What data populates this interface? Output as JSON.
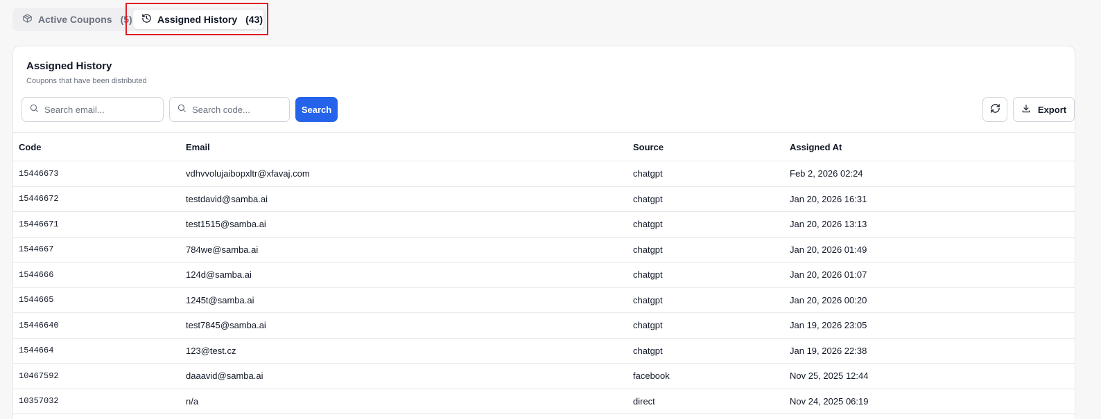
{
  "tabs": [
    {
      "label": "Active Coupons",
      "count": "(5)",
      "icon": "package-icon"
    },
    {
      "label": "Assigned History",
      "count": "(43)",
      "icon": "history-icon"
    }
  ],
  "card": {
    "title": "Assigned History",
    "subtitle": "Coupons that have been distributed"
  },
  "toolbar": {
    "email_placeholder": "Search email...",
    "code_placeholder": "Search code...",
    "search_label": "Search",
    "export_label": "Export"
  },
  "table": {
    "headers": [
      "Code",
      "Email",
      "Source",
      "Assigned At"
    ],
    "rows": [
      {
        "code": "15446673",
        "email": "vdhvvolujaibopxltr@xfavaj.com",
        "source": "chatgpt",
        "assigned_at": "Feb 2, 2026 02:24"
      },
      {
        "code": "15446672",
        "email": "testdavid@samba.ai",
        "source": "chatgpt",
        "assigned_at": "Jan 20, 2026 16:31"
      },
      {
        "code": "15446671",
        "email": "test1515@samba.ai",
        "source": "chatgpt",
        "assigned_at": "Jan 20, 2026 13:13"
      },
      {
        "code": "1544667",
        "email": "784we@samba.ai",
        "source": "chatgpt",
        "assigned_at": "Jan 20, 2026 01:49"
      },
      {
        "code": "1544666",
        "email": "124d@samba.ai",
        "source": "chatgpt",
        "assigned_at": "Jan 20, 2026 01:07"
      },
      {
        "code": "1544665",
        "email": "1245t@samba.ai",
        "source": "chatgpt",
        "assigned_at": "Jan 20, 2026 00:20"
      },
      {
        "code": "15446640",
        "email": "test7845@samba.ai",
        "source": "chatgpt",
        "assigned_at": "Jan 19, 2026 23:05"
      },
      {
        "code": "1544664",
        "email": "123@test.cz",
        "source": "chatgpt",
        "assigned_at": "Jan 19, 2026 22:38"
      },
      {
        "code": "10467592",
        "email": "daaavid@samba.ai",
        "source": "facebook",
        "assigned_at": "Nov 25, 2025 12:44"
      },
      {
        "code": "10357032",
        "email": "n/a",
        "source": "direct",
        "assigned_at": "Nov 24, 2025 06:19"
      }
    ]
  },
  "colors": {
    "accent": "#2563eb",
    "highlight": "#e11d26"
  }
}
